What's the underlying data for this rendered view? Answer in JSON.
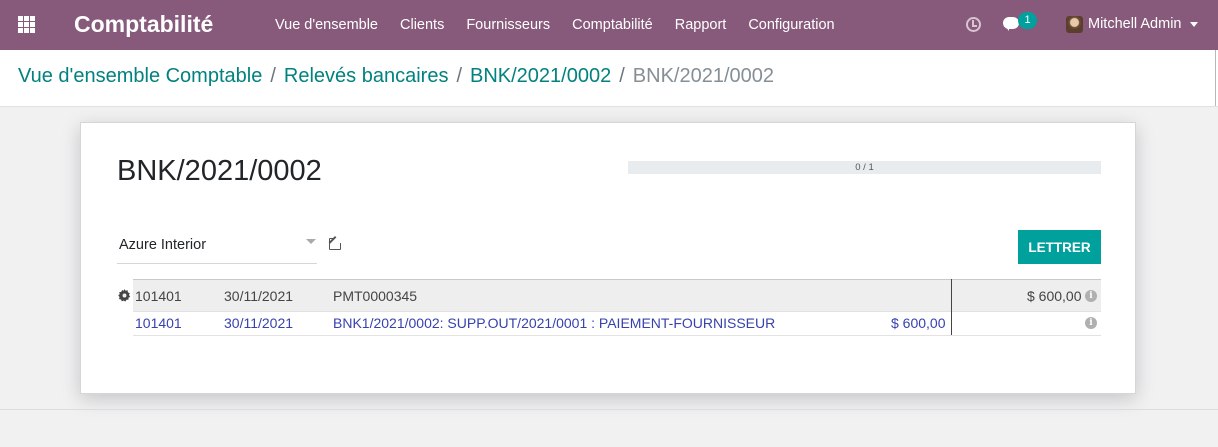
{
  "navbar": {
    "brand": "Comptabilité",
    "menu": [
      "Vue d'ensemble",
      "Clients",
      "Fournisseurs",
      "Comptabilité",
      "Rapport",
      "Configuration"
    ],
    "chat_count": "1",
    "user_name": "Mitchell Admin",
    "color": "#875a7b"
  },
  "breadcrumb": {
    "items": [
      "Vue d'ensemble Comptable",
      "Relevés bancaires",
      "BNK/2021/0002"
    ],
    "separator": "/",
    "current": "BNK/2021/0002"
  },
  "reconciliation": {
    "title": "BNK/2021/0002",
    "progress": {
      "label": "0 / 1",
      "fraction": 0
    },
    "partner": "Azure Interior",
    "button_label": "LETTRER",
    "statement_line": {
      "account": "101401",
      "date": "30/11/2021",
      "label": "PMT0000345",
      "amount": "$ 600,00"
    },
    "proposition_line": {
      "account": "101401",
      "date": "30/11/2021",
      "label": "BNK1/2021/0002: SUPP.OUT/2021/0001 : PAIEMENT-FOURNISSEUR",
      "amount": "$ 600,00"
    },
    "info_glyph": "i",
    "accent_color": "#00a09d"
  }
}
